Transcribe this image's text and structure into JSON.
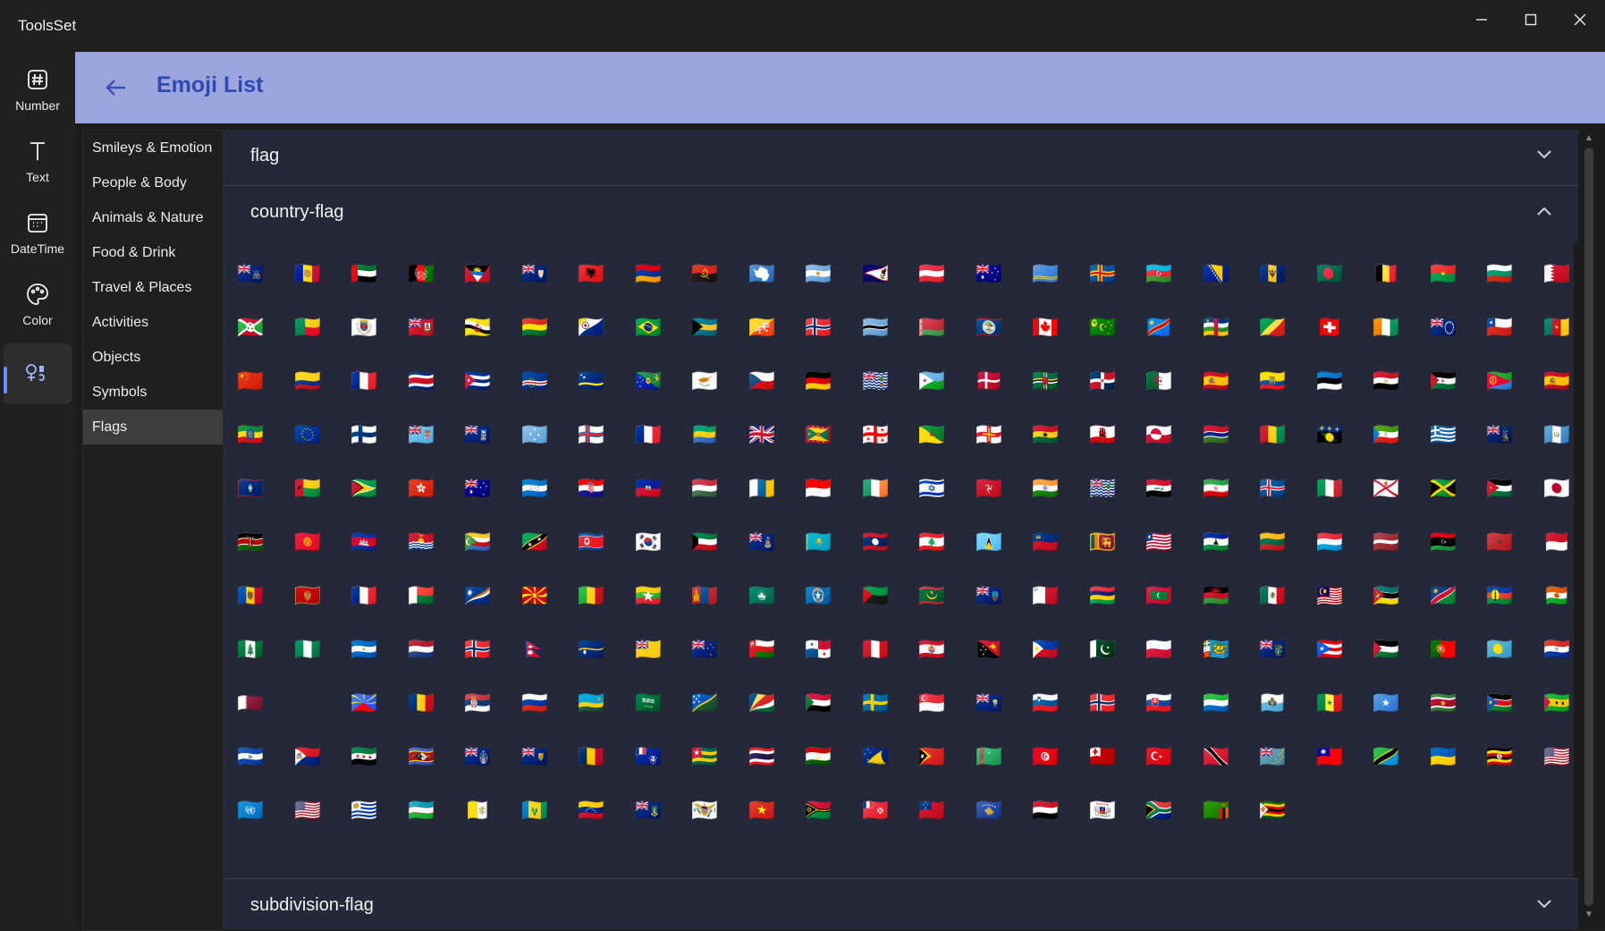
{
  "app": {
    "title": "ToolsSet"
  },
  "window_controls": {
    "minimize_icon": "minimize-icon",
    "maximize_icon": "maximize-icon",
    "close_icon": "close-icon"
  },
  "rail": {
    "items": [
      {
        "label": "Number",
        "icon": "hash-icon"
      },
      {
        "label": "Text",
        "icon": "text-icon"
      },
      {
        "label": "DateTime",
        "icon": "calendar-icon"
      },
      {
        "label": "Color",
        "icon": "palette-icon"
      },
      {
        "label": "",
        "icon": "emoji-tools-icon",
        "active": true
      }
    ]
  },
  "header": {
    "title": "Emoji List",
    "back_icon": "back-arrow-icon",
    "background": "#9ba6dd",
    "accent": "#3048b4"
  },
  "categories": [
    "Smileys & Emotion",
    "People & Body",
    "Animals & Nature",
    "Food & Drink",
    "Travel & Places",
    "Activities",
    "Objects",
    "Symbols",
    "Flags"
  ],
  "selected_category": "Flags",
  "sections": [
    {
      "label": "flag",
      "expanded": false
    },
    {
      "label": "country-flag",
      "expanded": true
    },
    {
      "label": "subdivision-flag",
      "expanded": false
    }
  ],
  "country_flags": [
    "🇦🇨",
    "🇦🇩",
    "🇦🇪",
    "🇦🇫",
    "🇦🇬",
    "🇦🇮",
    "🇦🇱",
    "🇦🇲",
    "🇦🇴",
    "🇦🇶",
    "🇦🇷",
    "🇦🇸",
    "🇦🇹",
    "🇦🇺",
    "🇦🇼",
    "🇦🇽",
    "🇦🇿",
    "🇧🇦",
    "🇧🇧",
    "🇧🇩",
    "🇧🇪",
    "🇧🇫",
    "🇧🇬",
    "🇧🇭",
    "🇧🇮",
    "🇧🇯",
    "🇧🇱",
    "🇧🇲",
    "🇧🇳",
    "🇧🇴",
    "🇧🇶",
    "🇧🇷",
    "🇧🇸",
    "🇧🇹",
    "🇧🇻",
    "🇧🇼",
    "🇧🇾",
    "🇧🇿",
    "🇨🇦",
    "🇨🇨",
    "🇨🇩",
    "🇨🇫",
    "🇨🇬",
    "🇨🇭",
    "🇨🇮",
    "🇨🇰",
    "🇨🇱",
    "🇨🇲",
    "🇨🇳",
    "🇨🇴",
    "🇨🇵",
    "🇨🇷",
    "🇨🇺",
    "🇨🇻",
    "🇨🇼",
    "🇨🇽",
    "🇨🇾",
    "🇨🇿",
    "🇩🇪",
    "🇩🇬",
    "🇩🇯",
    "🇩🇰",
    "🇩🇲",
    "🇩🇴",
    "🇩🇿",
    "🇪🇦",
    "🇪🇨",
    "🇪🇪",
    "🇪🇬",
    "🇪🇭",
    "🇪🇷",
    "🇪🇸",
    "🇪🇹",
    "🇪🇺",
    "🇫🇮",
    "🇫🇯",
    "🇫🇰",
    "🇫🇲",
    "🇫🇴",
    "🇫🇷",
    "🇬🇦",
    "🇬🇧",
    "🇬🇩",
    "🇬🇪",
    "🇬🇫",
    "🇬🇬",
    "🇬🇭",
    "🇬🇮",
    "🇬🇱",
    "🇬🇲",
    "🇬🇳",
    "🇬🇵",
    "🇬🇶",
    "🇬🇷",
    "🇬🇸",
    "🇬🇹",
    "🇬🇺",
    "🇬🇼",
    "🇬🇾",
    "🇭🇰",
    "🇭🇲",
    "🇭🇳",
    "🇭🇷",
    "🇭🇹",
    "🇭🇺",
    "🇮🇨",
    "🇮🇩",
    "🇮🇪",
    "🇮🇱",
    "🇮🇲",
    "🇮🇳",
    "🇮🇴",
    "🇮🇶",
    "🇮🇷",
    "🇮🇸",
    "🇮🇹",
    "🇯🇪",
    "🇯🇲",
    "🇯🇴",
    "🇯🇵",
    "🇰🇪",
    "🇰🇬",
    "🇰🇭",
    "🇰🇮",
    "🇰🇲",
    "🇰🇳",
    "🇰🇵",
    "🇰🇷",
    "🇰🇼",
    "🇰🇾",
    "🇰🇿",
    "🇱🇦",
    "🇱🇧",
    "🇱🇨",
    "🇱🇮",
    "🇱🇰",
    "🇱🇷",
    "🇱🇸",
    "🇱🇹",
    "🇱🇺",
    "🇱🇻",
    "🇱🇾",
    "🇲🇦",
    "🇲🇨",
    "🇲🇩",
    "🇲🇪",
    "🇲🇫",
    "🇲🇬",
    "🇲🇭",
    "🇲🇰",
    "🇲🇱",
    "🇲🇲",
    "🇲🇳",
    "🇲🇴",
    "🇲🇵",
    "🇲🇶",
    "🇲🇷",
    "🇲🇸",
    "🇲🇹",
    "🇲🇺",
    "🇲🇻",
    "🇲🇼",
    "🇲🇽",
    "🇲🇾",
    "🇲🇿",
    "🇳🇦",
    "🇳🇨",
    "🇳🇪",
    "🇳🇫",
    "🇳🇬",
    "🇳🇮",
    "🇳🇱",
    "🇳🇴",
    "🇳🇵",
    "🇳🇷",
    "🇳🇺",
    "🇳🇿",
    "🇴🇲",
    "🇵🇦",
    "🇵🇪",
    "🇵🇫",
    "🇵🇬",
    "🇵🇭",
    "🇵🇰",
    "🇵🇱",
    "🇵🇲",
    "🇵🇳",
    "🇵🇷",
    "🇵🇸",
    "🇵🇹",
    "🇵🇼",
    "🇵🇾",
    "🇶🇦",
    "",
    "🇷🇪",
    "🇷🇴",
    "🇷🇸",
    "🇷🇺",
    "🇷🇼",
    "🇸🇦",
    "🇸🇧",
    "🇸🇨",
    "🇸🇩",
    "🇸🇪",
    "🇸🇬",
    "🇸🇭",
    "🇸🇮",
    "🇸🇯",
    "🇸🇰",
    "🇸🇱",
    "🇸🇲",
    "🇸🇳",
    "🇸🇴",
    "🇸🇷",
    "🇸🇸",
    "🇸🇹",
    "🇸🇻",
    "🇸🇽",
    "🇸🇾",
    "🇸🇿",
    "🇹🇦",
    "🇹🇨",
    "🇹🇩",
    "🇹🇫",
    "🇹🇬",
    "🇹🇭",
    "🇹🇯",
    "🇹🇰",
    "🇹🇱",
    "🇹🇲",
    "🇹🇳",
    "🇹🇴",
    "🇹🇷",
    "🇹🇹",
    "🇹🇻",
    "🇹🇼",
    "🇹🇿",
    "🇺🇦",
    "🇺🇬",
    "🇺🇲",
    "🇺🇳",
    "🇺🇸",
    "🇺🇾",
    "🇺🇿",
    "🇻🇦",
    "🇻🇨",
    "🇻🇪",
    "🇻🇬",
    "🇻🇮",
    "🇻🇳",
    "🇻🇺",
    "🇼🇫",
    "🇼🇸",
    "🇽🇰",
    "🇾🇪",
    "🇾🇹",
    "🇿🇦",
    "🇿🇲",
    "🇿🇼"
  ]
}
